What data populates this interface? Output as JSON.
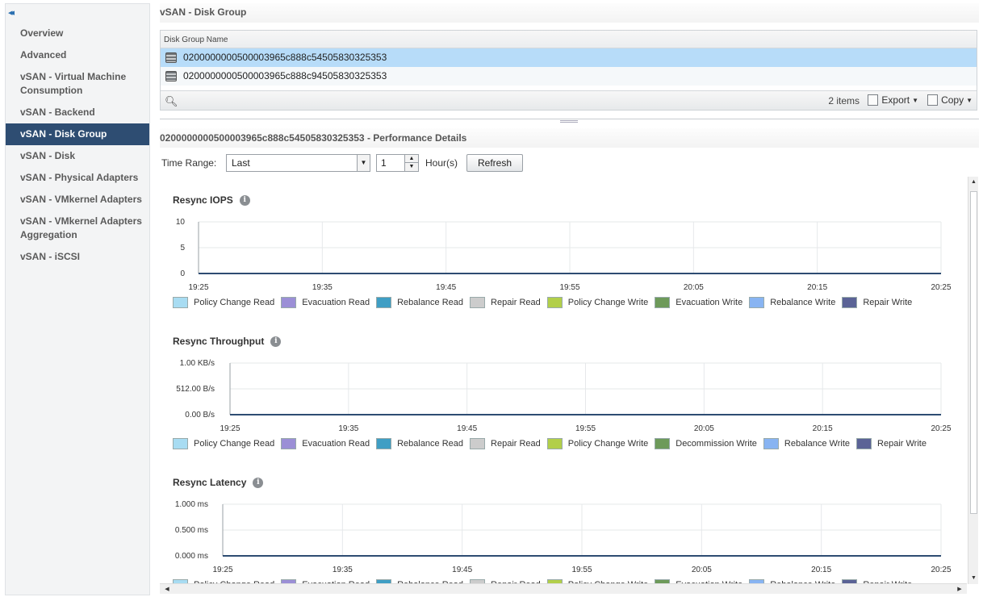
{
  "sidebar": {
    "collapse_label": "◂◂",
    "items": [
      {
        "label": "Overview",
        "active": false
      },
      {
        "label": "Advanced",
        "active": false
      },
      {
        "label": "vSAN - Virtual Machine Consumption",
        "active": false
      },
      {
        "label": "vSAN - Backend",
        "active": false
      },
      {
        "label": "vSAN - Disk Group",
        "active": true
      },
      {
        "label": "vSAN - Disk",
        "active": false
      },
      {
        "label": "vSAN - Physical Adapters",
        "active": false
      },
      {
        "label": "vSAN - VMkernel Adapters",
        "active": false
      },
      {
        "label": "vSAN - VMkernel Adapters Aggregation",
        "active": false
      },
      {
        "label": "vSAN - iSCSI",
        "active": false
      }
    ]
  },
  "disk_group": {
    "title": "vSAN - Disk Group",
    "column_header": "Disk Group Name",
    "rows": [
      {
        "name": "0200000000500003965c888c54505830325353",
        "selected": true
      },
      {
        "name": "0200000000500003965c888c94505830325353",
        "selected": false
      }
    ],
    "items_count": "2 items",
    "export_label": "Export",
    "copy_label": "Copy"
  },
  "performance": {
    "title": "0200000000500003965c888c54505830325353 - Performance Details",
    "time_range_label": "Time Range:",
    "time_range_value": "Last",
    "hours_value": "1",
    "hours_unit": "Hour(s)",
    "refresh_label": "Refresh"
  },
  "colors": {
    "policy_change_read": "#a8dcf2",
    "evacuation_read": "#9b8fd6",
    "rebalance_read": "#3f9ec4",
    "repair_read": "#cccccc",
    "policy_change_write": "#b2cf4a",
    "evacuation_write": "#6d9a5a",
    "rebalance_write": "#88b4f2",
    "repair_write": "#5b6396",
    "line": "#2e4d72",
    "selected_row": "#b7dcf9",
    "active_nav": "#2e4d72"
  },
  "chart_data": [
    {
      "type": "line",
      "title": "Resync IOPS",
      "x_ticks": [
        "19:25",
        "19:35",
        "19:45",
        "19:55",
        "20:05",
        "20:15",
        "20:25"
      ],
      "y_ticks": [
        "10",
        "5",
        "0"
      ],
      "ylim": [
        0,
        10
      ],
      "series": [
        {
          "name": "Policy Change Read",
          "color": "#a8dcf2",
          "values": [
            0,
            0,
            0,
            0,
            0,
            0,
            0
          ]
        },
        {
          "name": "Evacuation Read",
          "color": "#9b8fd6",
          "values": [
            0,
            0,
            0,
            0,
            0,
            0,
            0
          ]
        },
        {
          "name": "Rebalance Read",
          "color": "#3f9ec4",
          "values": [
            0,
            0,
            0,
            0,
            0,
            0,
            0
          ]
        },
        {
          "name": "Repair Read",
          "color": "#cccccc",
          "values": [
            0,
            0,
            0,
            0,
            0,
            0,
            0
          ]
        },
        {
          "name": "Policy Change Write",
          "color": "#b2cf4a",
          "values": [
            0,
            0,
            0,
            0,
            0,
            0,
            0
          ]
        },
        {
          "name": "Evacuation Write",
          "color": "#6d9a5a",
          "values": [
            0,
            0,
            0,
            0,
            0,
            0,
            0
          ]
        },
        {
          "name": "Rebalance Write",
          "color": "#88b4f2",
          "values": [
            0,
            0,
            0,
            0,
            0,
            0,
            0
          ]
        },
        {
          "name": "Repair Write",
          "color": "#5b6396",
          "values": [
            0,
            0,
            0,
            0,
            0,
            0,
            0
          ]
        }
      ]
    },
    {
      "type": "line",
      "title": "Resync Throughput",
      "x_ticks": [
        "19:25",
        "19:35",
        "19:45",
        "19:55",
        "20:05",
        "20:15",
        "20:25"
      ],
      "y_ticks": [
        "1.00 KB/s",
        "512.00 B/s",
        "0.00 B/s"
      ],
      "ylim": [
        0,
        1024
      ],
      "series": [
        {
          "name": "Policy Change Read",
          "color": "#a8dcf2",
          "values": [
            0,
            0,
            0,
            0,
            0,
            0,
            0
          ]
        },
        {
          "name": "Evacuation Read",
          "color": "#9b8fd6",
          "values": [
            0,
            0,
            0,
            0,
            0,
            0,
            0
          ]
        },
        {
          "name": "Rebalance Read",
          "color": "#3f9ec4",
          "values": [
            0,
            0,
            0,
            0,
            0,
            0,
            0
          ]
        },
        {
          "name": "Repair Read",
          "color": "#cccccc",
          "values": [
            0,
            0,
            0,
            0,
            0,
            0,
            0
          ]
        },
        {
          "name": "Policy Change Write",
          "color": "#b2cf4a",
          "values": [
            0,
            0,
            0,
            0,
            0,
            0,
            0
          ]
        },
        {
          "name": "Decommission Write",
          "color": "#6d9a5a",
          "values": [
            0,
            0,
            0,
            0,
            0,
            0,
            0
          ]
        },
        {
          "name": "Rebalance Write",
          "color": "#88b4f2",
          "values": [
            0,
            0,
            0,
            0,
            0,
            0,
            0
          ]
        },
        {
          "name": "Repair Write",
          "color": "#5b6396",
          "values": [
            0,
            0,
            0,
            0,
            0,
            0,
            0
          ]
        }
      ]
    },
    {
      "type": "line",
      "title": "Resync Latency",
      "x_ticks": [
        "19:25",
        "19:35",
        "19:45",
        "19:55",
        "20:05",
        "20:15",
        "20:25"
      ],
      "y_ticks": [
        "1.000 ms",
        "0.500 ms",
        "0.000 ms"
      ],
      "ylim": [
        0,
        1
      ],
      "series": [
        {
          "name": "Policy Change Read",
          "color": "#a8dcf2",
          "values": [
            0,
            0,
            0,
            0,
            0,
            0,
            0
          ]
        },
        {
          "name": "Evacuation Read",
          "color": "#9b8fd6",
          "values": [
            0,
            0,
            0,
            0,
            0,
            0,
            0
          ]
        },
        {
          "name": "Rebalance Read",
          "color": "#3f9ec4",
          "values": [
            0,
            0,
            0,
            0,
            0,
            0,
            0
          ]
        },
        {
          "name": "Repair Read",
          "color": "#cccccc",
          "values": [
            0,
            0,
            0,
            0,
            0,
            0,
            0
          ]
        },
        {
          "name": "Policy Change Write",
          "color": "#b2cf4a",
          "values": [
            0,
            0,
            0,
            0,
            0,
            0,
            0
          ]
        },
        {
          "name": "Evacuation Write",
          "color": "#6d9a5a",
          "values": [
            0,
            0,
            0,
            0,
            0,
            0,
            0
          ]
        },
        {
          "name": "Rebalance Write",
          "color": "#88b4f2",
          "values": [
            0,
            0,
            0,
            0,
            0,
            0,
            0
          ]
        },
        {
          "name": "Repair Write",
          "color": "#5b6396",
          "values": [
            0,
            0,
            0,
            0,
            0,
            0,
            0
          ]
        }
      ]
    }
  ]
}
